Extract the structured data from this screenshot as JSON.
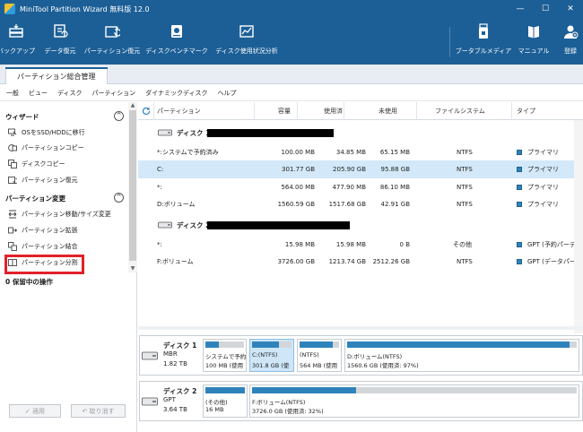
{
  "window": {
    "title": "MiniTool Partition Wizard 無料版 12.0",
    "minimize": "—",
    "maximize": "☐",
    "close": "✕"
  },
  "toolbar": {
    "backup": "バックアップ",
    "data_recovery": "データ復元",
    "partition_recovery": "パーティション復元",
    "disk_benchmark": "ディスクベンチマーク",
    "space_analyzer": "ディスク使用状況分析",
    "bootable_media": "ブータブルメディア",
    "manual": "マニュアル",
    "register": "登録"
  },
  "tab": {
    "label": "パーティション総合管理"
  },
  "menu": [
    "一般",
    "ビュー",
    "ディスク",
    "パーティション",
    "ダイナミックディスク",
    "ヘルプ"
  ],
  "sidebar": {
    "wizard_title": "ウィザード",
    "wizard_items": [
      "OSをSSD/HDDに移行",
      "パーティションコピー",
      "ディスクコピー",
      "パーティション復元"
    ],
    "change_title": "パーティション変更",
    "change_items": [
      "パーティション移動/サイズ変更",
      "パーティション拡張",
      "パーティション結合",
      "パーティション分割"
    ],
    "pending": "0 保留中の操作",
    "apply": "適用",
    "undo": "取り消す"
  },
  "table": {
    "columns": [
      "パーティション",
      "容量",
      "使用済",
      "未使用",
      "ファイルシステム",
      "タイプ"
    ],
    "disk1_label": "ディスク 1",
    "disk2_label": "ディスク 2",
    "disk1_rows": [
      {
        "name": "*:システムで予約済み",
        "capacity": "100.00 MB",
        "used": "34.85 MB",
        "unused": "65.15 MB",
        "fs": "NTFS",
        "type": "プライマリ"
      },
      {
        "name": "C:",
        "capacity": "301.77 GB",
        "used": "205.90 GB",
        "unused": "95.88 GB",
        "fs": "NTFS",
        "type": "プライマリ"
      },
      {
        "name": "*:",
        "capacity": "564.00 MB",
        "used": "477.90 MB",
        "unused": "86.10 MB",
        "fs": "NTFS",
        "type": "プライマリ"
      },
      {
        "name": "D:ボリューム",
        "capacity": "1560.59 GB",
        "used": "1517.68 GB",
        "unused": "42.91 GB",
        "fs": "NTFS",
        "type": "プライマリ"
      }
    ],
    "disk2_rows": [
      {
        "name": "*:",
        "capacity": "15.98 MB",
        "used": "15.98 MB",
        "unused": "0 B",
        "fs": "その他",
        "type": "GPT (予約パーティション)"
      },
      {
        "name": "F:ボリューム",
        "capacity": "3726.00 GB",
        "used": "1213.74 GB",
        "unused": "2512.26 GB",
        "fs": "NTFS",
        "type": "GPT (データパーティション)"
      }
    ]
  },
  "diskmap": {
    "disk1": {
      "name": "ディスク 1",
      "style": "MBR",
      "size": "1.82 TB",
      "parts": [
        {
          "l1": "システムで予約",
          "l2": "100 MB (使用",
          "fill": 0.35
        },
        {
          "l1": "C:(NTFS)",
          "l2": "301.8 GB (使",
          "fill": 0.68
        },
        {
          "l1": "(NTFS)",
          "l2": "564 MB (使用",
          "fill": 0.85
        },
        {
          "l1": "D:ボリューム(NTFS)",
          "l2": "1560.6 GB (使用済: 97%)",
          "fill": 0.97
        }
      ]
    },
    "disk2": {
      "name": "ディスク 2",
      "style": "GPT",
      "size": "3.64 TB",
      "parts": [
        {
          "l1": "(その他)",
          "l2": "16 MB",
          "fill": 1.0
        },
        {
          "l1": "F:ボリューム(NTFS)",
          "l2": "3726.0 GB (使用済: 32%)",
          "fill": 0.32
        }
      ]
    }
  },
  "colors": {
    "brand": "#1c5f96",
    "accent": "#2f83bc",
    "selection": "#d3e8f8",
    "highlight": "#e32029"
  }
}
